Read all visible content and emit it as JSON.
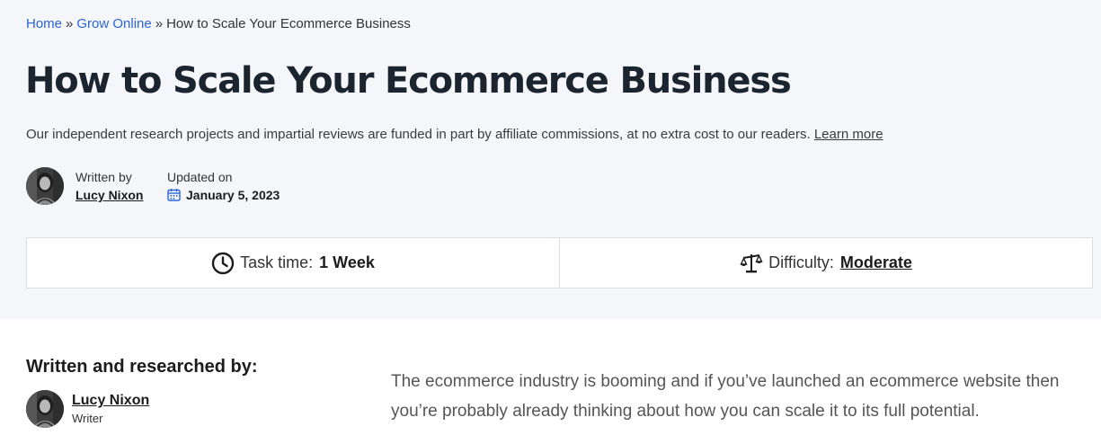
{
  "breadcrumb": {
    "home": "Home",
    "section": "Grow Online",
    "separator": "»",
    "current": "How to Scale Your Ecommerce Business"
  },
  "page_title": "How to Scale Your Ecommerce Business",
  "disclaimer": {
    "text": "Our independent research projects and impartial reviews are funded in part by affiliate commissions, at no extra cost to our readers.",
    "link": "Learn more"
  },
  "byline": {
    "written_by_label": "Written by",
    "author": "Lucy Nixon",
    "updated_label": "Updated on",
    "date": "January 5, 2023",
    "date_icon": "calendar-icon"
  },
  "stats": {
    "task_time": {
      "icon": "clock-icon",
      "label": "Task time:",
      "value": "1 Week"
    },
    "difficulty": {
      "icon": "scale-icon",
      "label": "Difficulty:",
      "value": "Moderate"
    }
  },
  "researched": {
    "heading": "Written and researched by:",
    "name": "Lucy Nixon",
    "role": "Writer"
  },
  "intro": "The ecommerce industry is booming and if you’ve launched an ecommerce website then you’re probably already thinking about how you can scale it to its full potential.",
  "colors": {
    "link_blue": "#2a66d6",
    "hero_background": "#f5f6fa",
    "title_color": "#1b2530",
    "calendar_icon": "#2a66d6"
  }
}
